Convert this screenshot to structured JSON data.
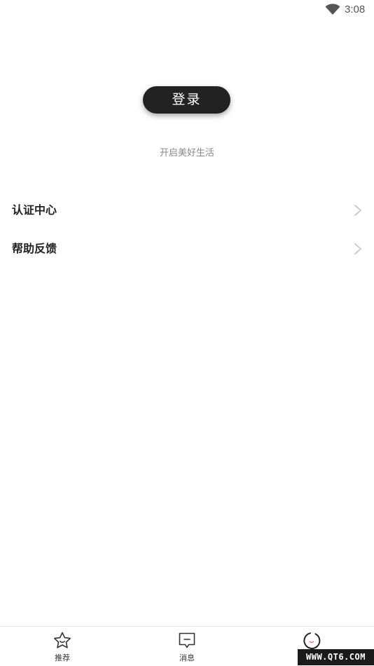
{
  "status_bar": {
    "time": "3:08",
    "wifi_icon": "wifi-icon"
  },
  "login": {
    "button_label": "登录",
    "tagline": "开启美好生活"
  },
  "menu": {
    "items": [
      {
        "label": "认证中心",
        "icon": "chevron-right-icon"
      },
      {
        "label": "帮助反馈",
        "icon": "chevron-right-icon"
      }
    ]
  },
  "tab_bar": {
    "tabs": [
      {
        "label": "推荐",
        "icon": "star-face-icon"
      },
      {
        "label": "消息",
        "icon": "message-icon"
      },
      {
        "label": "",
        "icon": "smile-ring-icon"
      }
    ]
  },
  "watermark": "WWW.QT6.COM",
  "colors": {
    "button_bg": "#222222",
    "tagline": "#888888",
    "chevron": "#c8c8c8"
  }
}
